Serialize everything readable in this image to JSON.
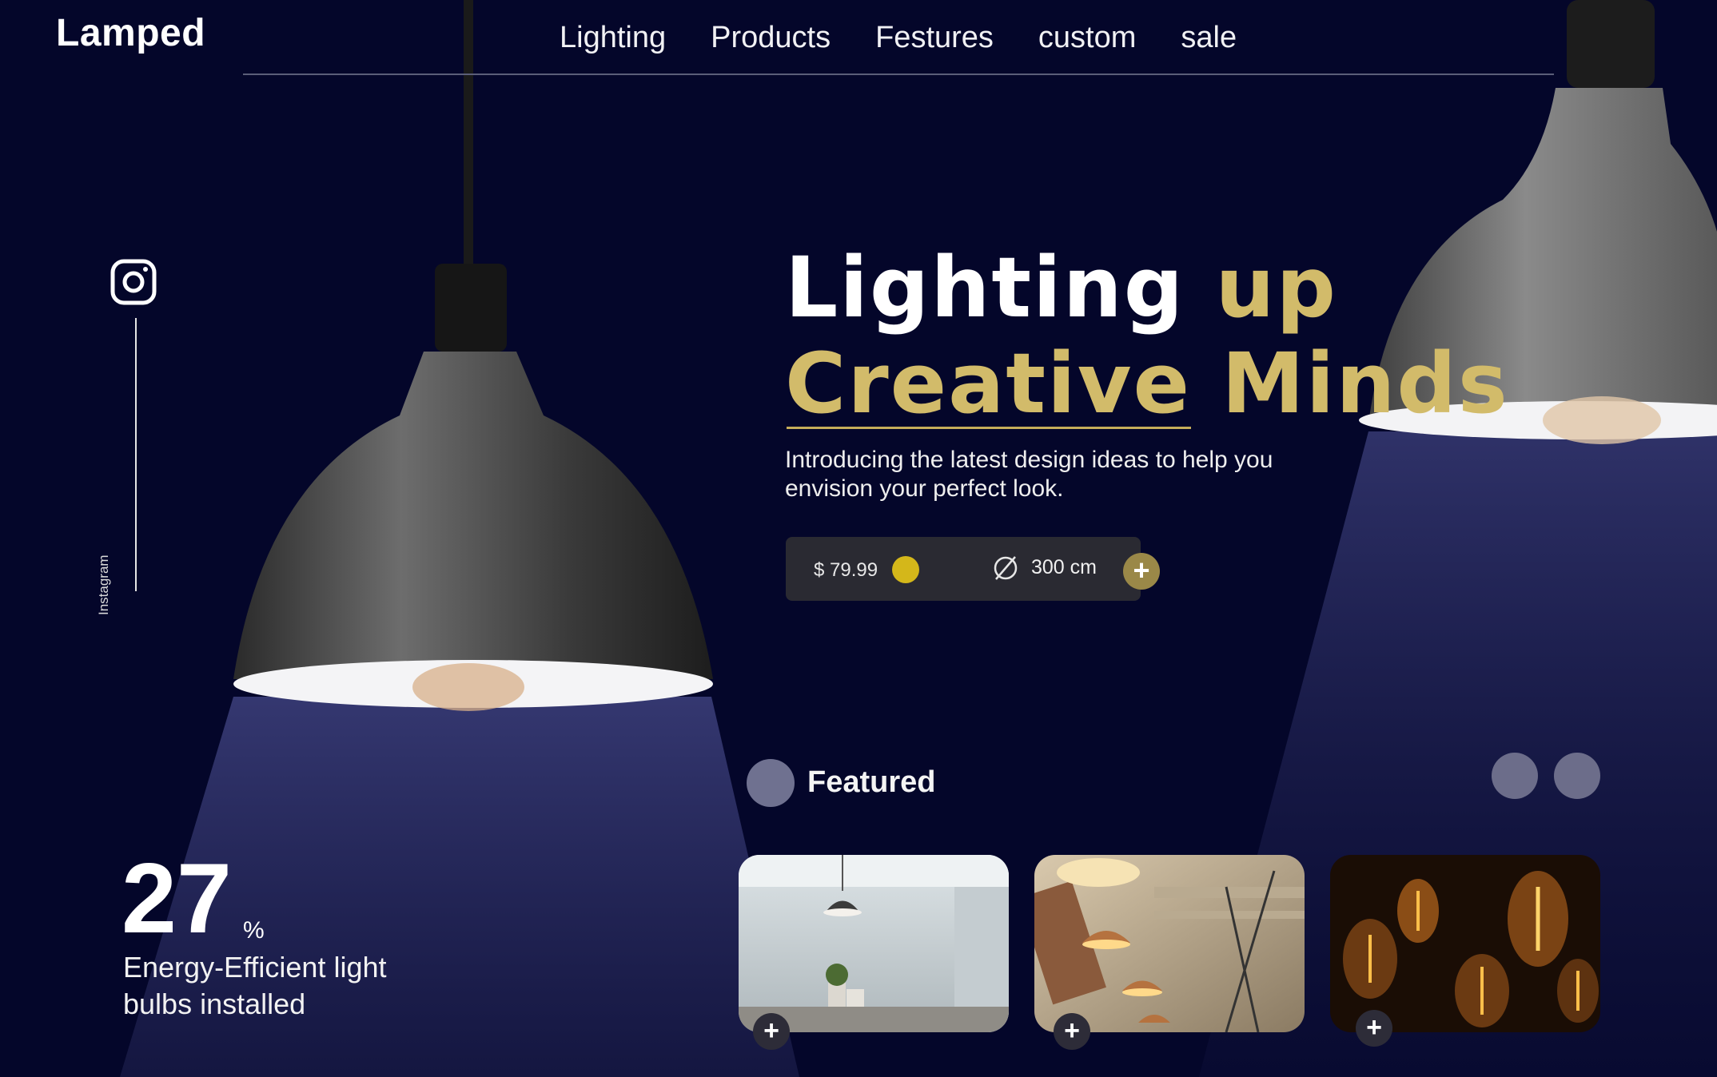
{
  "brand": {
    "name": "Lamped"
  },
  "nav": {
    "items": [
      "Lighting",
      "Products",
      "Festures",
      "custom",
      "sale"
    ]
  },
  "social": {
    "label": "Instagram",
    "icon": "instagram-icon"
  },
  "hero": {
    "line1_white": "Lighting",
    "line1_gold": "up",
    "line2_gold": "Creative Minds",
    "subtitle": "Introducing the latest design ideas to help you envision your perfect look."
  },
  "product": {
    "price": "$ 79.99",
    "size": "300 cm",
    "diameter_icon": "diameter-icon",
    "add_icon": "plus-icon"
  },
  "featured": {
    "label": "Featured",
    "add_icon": "plus-icon"
  },
  "stats": {
    "value": "27",
    "unit": "%",
    "label": "Energy-Efficient light bulbs installed"
  },
  "colors": {
    "background": "#04062a",
    "gold": "#d2bb6a",
    "accent_dot": "#d4b71a"
  }
}
